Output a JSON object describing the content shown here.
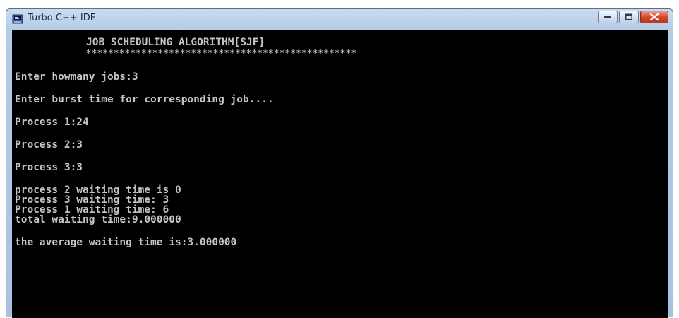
{
  "window": {
    "title": "Turbo C++ IDE",
    "icon": "turbo-cpp-app-icon",
    "buttons": {
      "minimize_icon": "minimize-icon",
      "maximize_icon": "maximize-icon",
      "close_icon": "close-icon"
    },
    "colors": {
      "console_background": "#000000",
      "console_text": "#c4c4c4",
      "close_button": "#c9402a"
    }
  },
  "console": {
    "heading": "JOB SCHEDULING ALGORITHM[SJF]",
    "separator": "*************************************************",
    "lines": [
      "Enter howmany jobs:3",
      "Enter burst time for corresponding job....",
      "Process 1:24",
      "Process 2:3",
      "Process 3:3",
      "process 2 waiting time is 0",
      "Process 3 waiting time: 3",
      "Process 1 waiting time: 6",
      "total waiting time:9.000000",
      "the average waiting time is:3.000000"
    ]
  }
}
